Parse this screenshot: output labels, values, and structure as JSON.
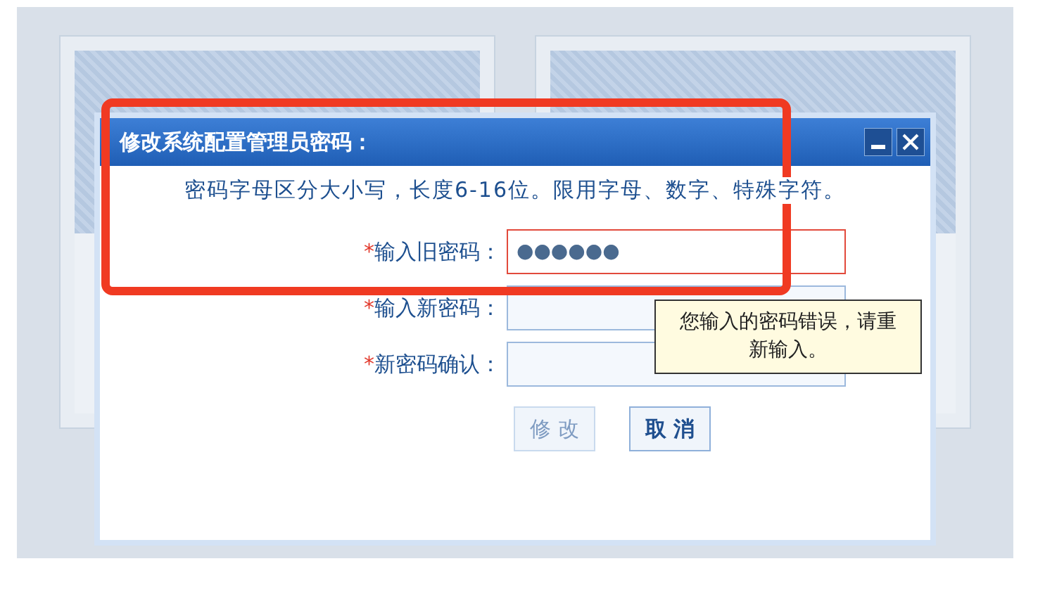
{
  "window": {
    "title": "修改系统配置管理员密码："
  },
  "hint": "密码字母区分大小写，长度6-16位。限用字母、数字、特殊字符。",
  "fields": [
    {
      "required_mark": "*",
      "label": "输入旧密码：",
      "value": "●●●●●●",
      "error": true
    },
    {
      "required_mark": "*",
      "label": "输入新密码：",
      "error": false
    },
    {
      "required_mark": "*",
      "label": "新密码确认：",
      "error": false
    }
  ],
  "buttons": [
    {
      "label": "修 改",
      "disabled": true
    },
    {
      "label": "取 消",
      "disabled": false
    }
  ],
  "tooltip": "您输入的密码错误，请重新输入。",
  "annotation": {
    "kind": "highlight"
  }
}
